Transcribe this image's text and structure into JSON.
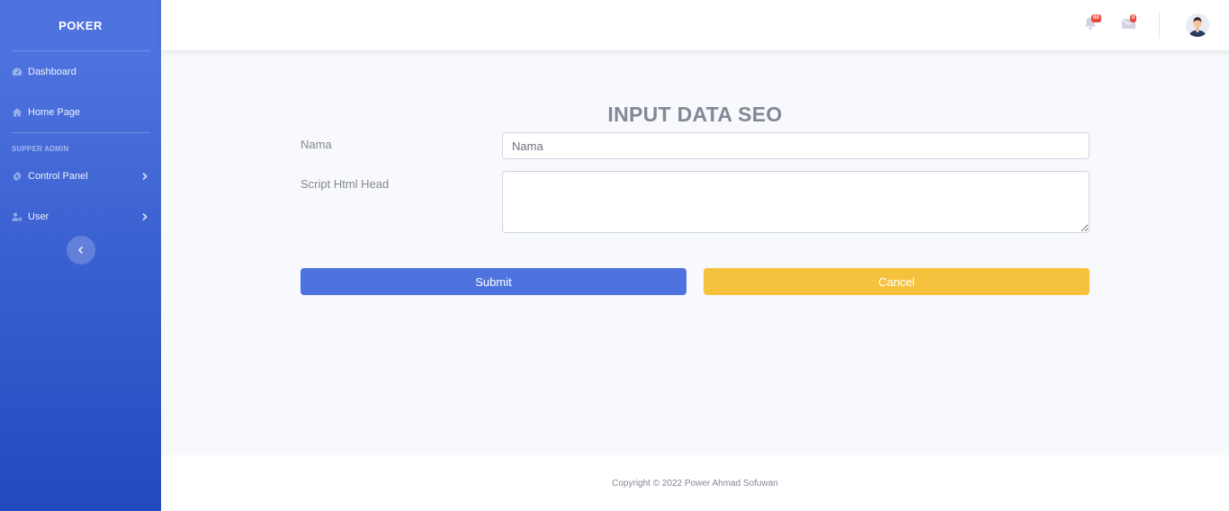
{
  "sidebar": {
    "brand": "POKER",
    "items": [
      {
        "label": "Dashboard",
        "icon": "tachometer-icon"
      },
      {
        "label": "Home Page",
        "icon": "home-icon"
      }
    ],
    "heading": "SUPPER ADMIN",
    "sub_items": [
      {
        "label": "Control Panel",
        "icon": "gear-icon"
      },
      {
        "label": "User",
        "icon": "user-cog-icon"
      }
    ]
  },
  "topbar": {
    "alerts_badge": "00",
    "messages_badge": "0"
  },
  "main": {
    "title": "INPUT DATA SEO",
    "form": {
      "nama_label": "Nama",
      "nama_placeholder": "Nama",
      "nama_value": "",
      "script_label": "Script Html Head",
      "script_value": "",
      "submit_label": "Submit",
      "cancel_label": "Cancel"
    }
  },
  "footer": {
    "copyright": "Copyright © 2022 Power Ahmad Sofuwan"
  },
  "colors": {
    "primary": "#4e73df",
    "primary_dark": "#224abe",
    "warning": "#f6c23e",
    "danger": "#e74a3b",
    "text_muted": "#858796",
    "background": "#f8f9fc"
  }
}
